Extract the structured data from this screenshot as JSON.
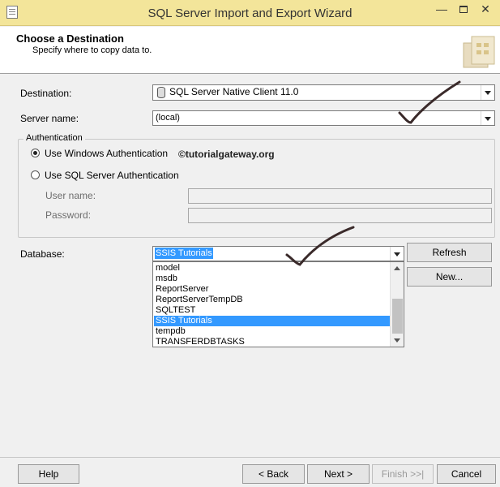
{
  "window": {
    "title": "SQL Server Import and Export Wizard"
  },
  "header": {
    "title": "Choose a Destination",
    "subtitle": "Specify where to copy data to."
  },
  "destination": {
    "label": "Destination:",
    "value": "SQL Server Native Client 11.0"
  },
  "server": {
    "label": "Server name:",
    "value": "(local)"
  },
  "auth": {
    "group_label": "Authentication",
    "windows_label": "Use Windows Authentication",
    "sql_label": "Use SQL Server Authentication",
    "username_label": "User name:",
    "password_label": "Password:",
    "selected": "windows"
  },
  "watermark": "©tutorialgateway.org",
  "database": {
    "label": "Database:",
    "value": "SSIS Tutorials",
    "options": [
      "model",
      "msdb",
      "ReportServer",
      "ReportServerTempDB",
      "SQLTEST",
      "SSIS Tutorials",
      "tempdb",
      "TRANSFERDBTASKS"
    ],
    "selected_index": 5
  },
  "buttons": {
    "refresh": "Refresh",
    "new": "New...",
    "help": "Help",
    "back": "< Back",
    "next": "Next >",
    "finish": "Finish >>|",
    "cancel": "Cancel"
  },
  "colors": {
    "title_bar": "#f3e59a",
    "selection": "#3399ff",
    "annotation_ink": "#3a2a2a"
  }
}
